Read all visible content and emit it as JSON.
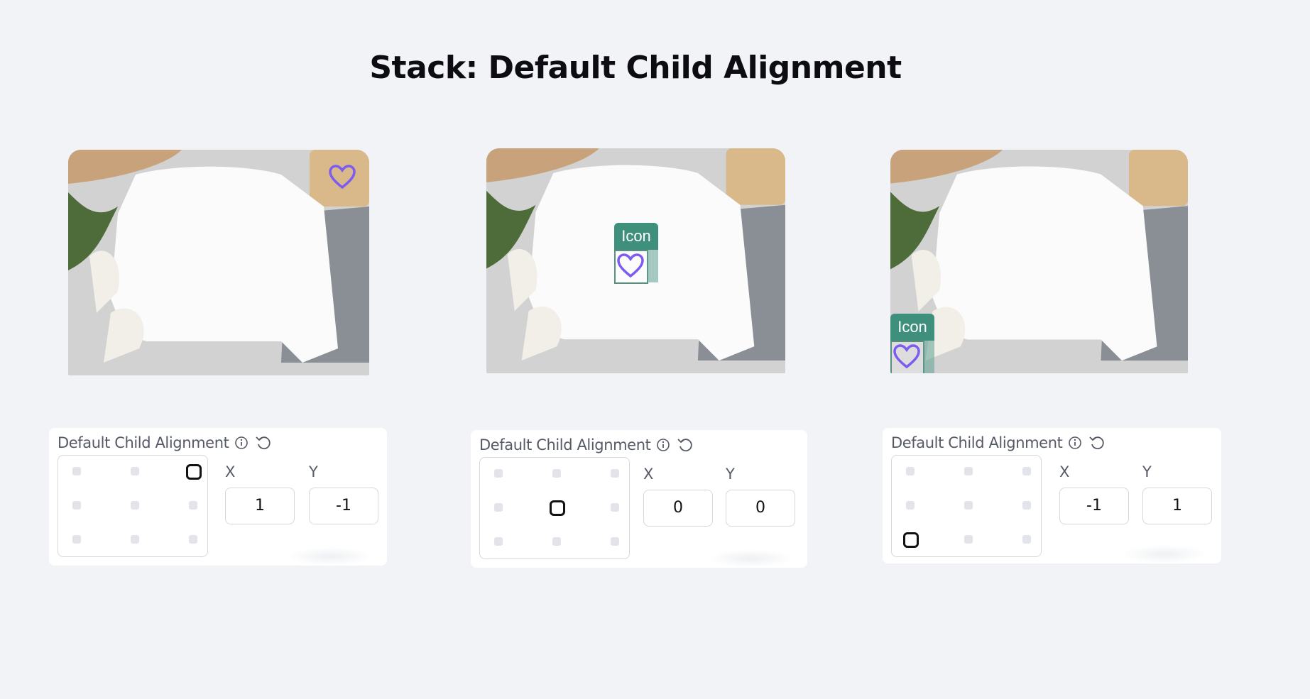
{
  "page": {
    "title": "Stack: Default Child Alignment"
  },
  "colors": {
    "accent": "#3e907c",
    "heart": "#7c5cf0",
    "background": "#f2f3f7"
  },
  "examples": [
    {
      "icon_label": "",
      "panel": {
        "label": "Default Child Alignment",
        "x_label": "X",
        "y_label": "Y",
        "x_value": "1",
        "y_value": "-1",
        "selected": "top-right"
      }
    },
    {
      "icon_label": "Icon",
      "panel": {
        "label": "Default Child Alignment",
        "x_label": "X",
        "y_label": "Y",
        "x_value": "0",
        "y_value": "0",
        "selected": "center"
      }
    },
    {
      "icon_label": "Icon",
      "panel": {
        "label": "Default Child Alignment",
        "x_label": "X",
        "y_label": "Y",
        "x_value": "-1",
        "y_value": "1",
        "selected": "bottom-left"
      }
    }
  ],
  "icons": {
    "info": "info-icon",
    "reset": "reset-icon",
    "heart": "heart-icon"
  }
}
